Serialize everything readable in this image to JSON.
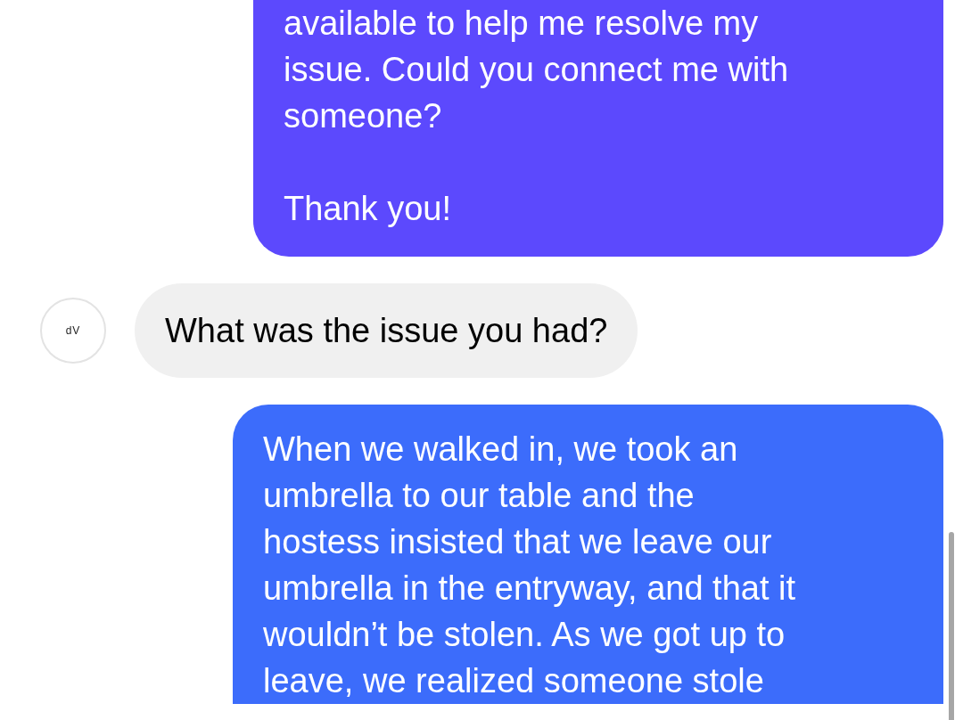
{
  "messages": [
    {
      "kind": "outgoing",
      "color": "#5c49fd",
      "paragraphs": [
        "available to help me resolve my\nissue. Could you connect me with\nsomeone?",
        "Thank you!"
      ]
    },
    {
      "kind": "incoming",
      "color": "#f0f0f0",
      "avatar": {
        "logo_text": "dV"
      },
      "paragraphs": [
        "What was the issue you had?"
      ]
    },
    {
      "kind": "outgoing",
      "color": "#3c6cfb",
      "paragraphs": [
        "When we walked in, we took an\numbrella to our table and the\nhostess insisted that we leave our\numbrella in the entryway, and that it\nwouldn’t be stolen. As we got up to\nleave, we realized someone stole"
      ]
    }
  ]
}
